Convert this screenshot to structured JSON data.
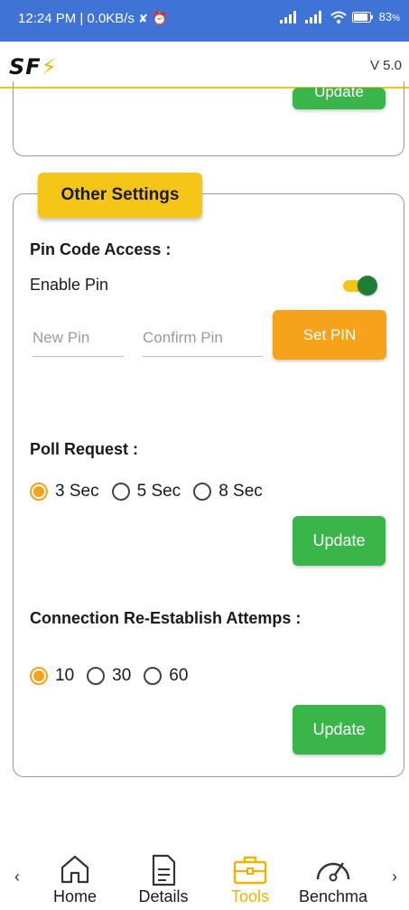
{
  "status_bar": {
    "time_speed": "12:24 PM | 0.0KB/s",
    "battery": "83",
    "battery_suffix": "%"
  },
  "app_bar": {
    "logo": "SF",
    "version": "V 5.0"
  },
  "top_card": {
    "update_label": "Update"
  },
  "other_settings": {
    "title": "Other Settings",
    "pin_section": {
      "heading": "Pin Code Access :",
      "enable_label": "Enable Pin",
      "enabled": true,
      "new_pin_placeholder": "New Pin",
      "confirm_pin_placeholder": "Confirm Pin",
      "set_pin_label": "Set PIN"
    },
    "poll_section": {
      "heading": "Poll Request :",
      "options": [
        "3 Sec",
        "5 Sec",
        "8 Sec"
      ],
      "selected": "3 Sec",
      "update_label": "Update"
    },
    "reconnect_section": {
      "heading": "Connection Re-Establish Attemps :",
      "options": [
        "10",
        "30",
        "60"
      ],
      "selected": "10",
      "update_label": "Update"
    }
  },
  "bottom_nav": {
    "prev": "‹",
    "next": "›",
    "items": [
      {
        "label": "Home",
        "icon": "home-icon"
      },
      {
        "label": "Details",
        "icon": "document-icon"
      },
      {
        "label": "Tools",
        "icon": "toolbox-icon",
        "active": true
      },
      {
        "label": "Benchma",
        "icon": "speedometer-icon"
      }
    ]
  },
  "colors": {
    "status_bar": "#3f73d6",
    "accent_yellow": "#f5c518",
    "accent_orange": "#f7a21b",
    "button_green": "#3ab54a",
    "toggle_thumb": "#1e7e34"
  }
}
